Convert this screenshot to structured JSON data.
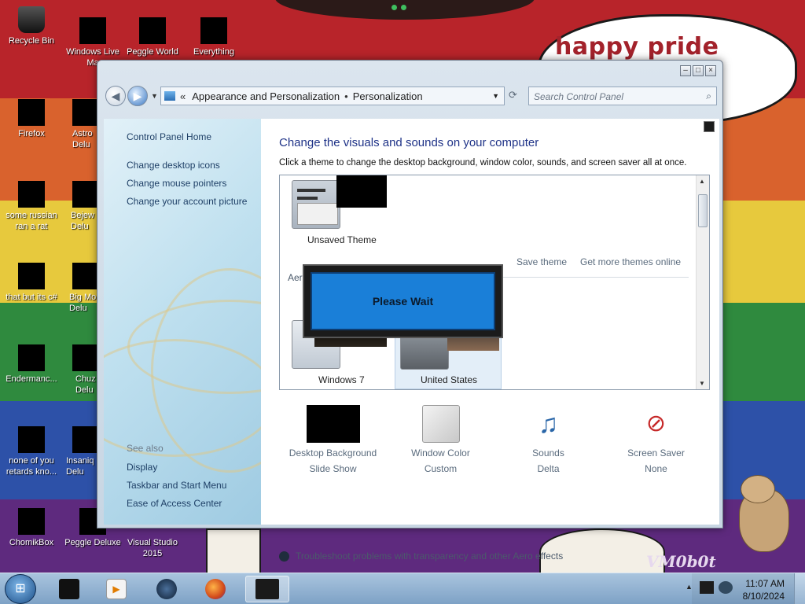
{
  "wallpaper": {
    "bubble_text": "happy pride month",
    "signature": "VM0b0t"
  },
  "desktop_icons": [
    {
      "label": "Recycle Bin"
    },
    {
      "label": "Windows Live Ma"
    },
    {
      "label": "Peggle World"
    },
    {
      "label": "Everything"
    },
    {
      "label": "Firefox"
    },
    {
      "label": "Astro Delu"
    },
    {
      "label": "some russian ran a rat"
    },
    {
      "label": "Bejew Delu"
    },
    {
      "label": "that but its c#"
    },
    {
      "label": "Big Mo Delu"
    },
    {
      "label": "Endermanc..."
    },
    {
      "label": "Chuz Delu"
    },
    {
      "label": "none of you retards kno..."
    },
    {
      "label": "Insaniq Delu"
    },
    {
      "label": "ChomikBox"
    },
    {
      "label": "Peggle Deluxe"
    },
    {
      "label": "Visual Studio 2015"
    }
  ],
  "window": {
    "breadcrumb": [
      "Appearance and Personalization",
      "Personalization"
    ],
    "search_placeholder": "Search Control Panel",
    "sidebar": {
      "home": "Control Panel Home",
      "links": [
        "Change desktop icons",
        "Change mouse pointers",
        "Change your account picture"
      ],
      "see_also_label": "See also",
      "see_also": [
        "Display",
        "Taskbar and Start Menu",
        "Ease of Access Center"
      ]
    },
    "title": "Change the visuals and sounds on your computer",
    "subtitle": "Click a theme to change the desktop background, window color, sounds, and screen saver all at once.",
    "themes": {
      "unsaved": "Unsaved Theme",
      "save_theme": "Save theme",
      "get_more": "Get more themes online",
      "aero_label": "Aero",
      "windows7": "Windows 7",
      "united_states": "United States"
    },
    "bottom": [
      {
        "name": "Desktop Background",
        "value": "Slide Show"
      },
      {
        "name": "Window Color",
        "value": "Custom"
      },
      {
        "name": "Sounds",
        "value": "Delta"
      },
      {
        "name": "Screen Saver",
        "value": "None"
      }
    ],
    "troubleshoot": "Troubleshoot problems with transparency and other Aero effects"
  },
  "dialog": {
    "text": "Please Wait"
  },
  "taskbar": {
    "time": "11:07 AM",
    "date": "8/10/2024"
  }
}
